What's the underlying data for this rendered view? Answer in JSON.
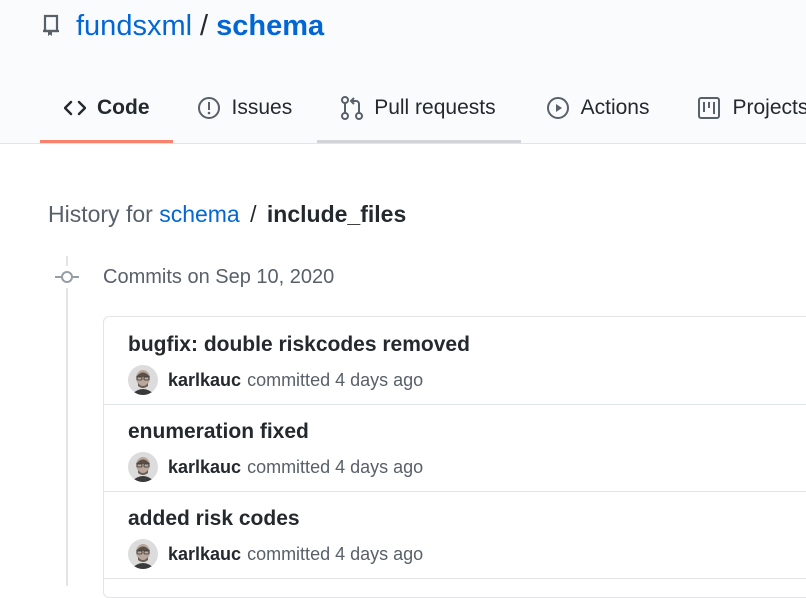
{
  "repo": {
    "owner": "fundsxml",
    "separator": "/",
    "name": "schema"
  },
  "tabs": [
    {
      "label": "Code",
      "icon": "code-icon"
    },
    {
      "label": "Issues",
      "icon": "issue-opened-icon"
    },
    {
      "label": "Pull requests",
      "icon": "git-pull-request-icon"
    },
    {
      "label": "Actions",
      "icon": "play-icon"
    },
    {
      "label": "Projects",
      "icon": "project-icon"
    }
  ],
  "history": {
    "prefix": "History for",
    "repo_link": "schema",
    "separator": "/",
    "path": "include_files"
  },
  "commit_group": {
    "date_label": "Commits on Sep 10, 2020"
  },
  "commits": [
    {
      "message": "bugfix: double riskcodes removed",
      "author": "karlkauc",
      "action": "committed",
      "time": "4 days ago"
    },
    {
      "message": "enumeration fixed",
      "author": "karlkauc",
      "action": "committed",
      "time": "4 days ago"
    },
    {
      "message": "added risk codes",
      "author": "karlkauc",
      "action": "committed",
      "time": "4 days ago"
    }
  ],
  "colors": {
    "link": "#0366d6",
    "active_tab_underline": "#f9826c",
    "muted_text": "#586069",
    "border": "#e1e4e8"
  }
}
